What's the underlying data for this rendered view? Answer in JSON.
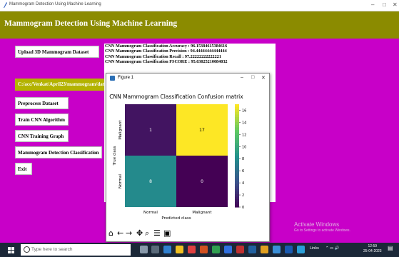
{
  "window": {
    "title": "Mammogram Detection Using Machine Learning"
  },
  "header": {
    "title": "Mammogram Detection Using Machine Learning"
  },
  "buttons": {
    "upload": "Upload 3D Mammogram Dataset",
    "preprocess": "Preprocess Dataset",
    "train": "Train CNN Algorithm",
    "graph": "CNN Training Graph",
    "classify": "Mammogram Detection Classification",
    "exit": "Exit"
  },
  "path_field": {
    "value": "C:/acc/Venkat/April23/mammogram/dataset"
  },
  "output_lines": [
    "CNN Mammogram Classification Accuracy  : 96.15384615384616",
    "CNN Mammogram Classification Precision : 94.44444444444444",
    "CNN Mammogram Classification Recall    : 97.22222222222221",
    "CNN Mammogram Classification FSCORE    : 95.63025210084032"
  ],
  "figure_window": {
    "title": "Figure 1",
    "toolbar_icons": [
      "home-icon",
      "back-arrow-icon",
      "forward-arrow-icon",
      "pan-icon",
      "zoom-icon",
      "configure-subplots-icon",
      "save-icon"
    ]
  },
  "chart_data": {
    "type": "heatmap",
    "title": "CNN Mammogram Classification Confusion matrix",
    "xlabel": "Predicted class",
    "ylabel": "True class",
    "x_categories": [
      "Normal",
      "Malignant"
    ],
    "y_categories": [
      "Malignant",
      "Normal"
    ],
    "values": [
      [
        1,
        17
      ],
      [
        8,
        0
      ]
    ],
    "colorbar": {
      "min": 0,
      "max": 17,
      "ticks": [
        0,
        2,
        4,
        6,
        8,
        10,
        12,
        14,
        16
      ]
    },
    "colormap": "viridis"
  },
  "watermark": {
    "line1": "Activate Windows",
    "line2": "Go to Settings to activate Windows."
  },
  "taskbar": {
    "search_placeholder": "Type here to search",
    "tray_text": "Links",
    "time": "12:59",
    "date": "25-04-2023"
  },
  "colors": {
    "background": "#c800c8",
    "header": "#8b8b00",
    "path_field": "#b3b300"
  }
}
